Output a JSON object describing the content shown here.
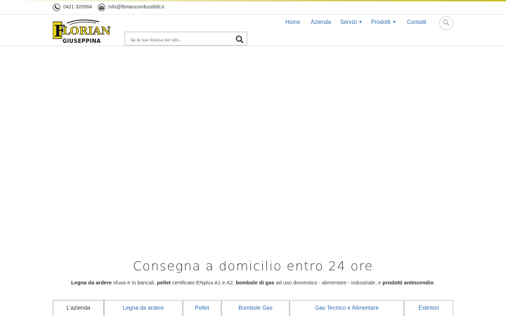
{
  "topbar": {
    "phone": "0421 320564",
    "email": "info@floriancombustibili.it"
  },
  "logo": {
    "line1": "FLORIAN",
    "line2": "GIUSEPPINA",
    "colors": {
      "yellow": "#e8d31a",
      "dark": "#111111"
    }
  },
  "search": {
    "placeholder": "fai la tua ricerca nel sito..."
  },
  "nav": {
    "items": [
      {
        "label": "Home",
        "dropdown": false
      },
      {
        "label": "Azienda",
        "dropdown": false
      },
      {
        "label": "Servizi",
        "dropdown": true
      },
      {
        "label": "Prodotti",
        "dropdown": true
      },
      {
        "label": "Contatti",
        "dropdown": false
      }
    ]
  },
  "hero": {
    "headline": "Consegna a domicilio entro 24 ore",
    "subline": [
      {
        "text": "Legna da ardere",
        "bold": true
      },
      {
        "text": " sfusa e in bancali, ",
        "bold": false
      },
      {
        "text": "pellet",
        "bold": true
      },
      {
        "text": " certificato ENplus A1 e A2, ",
        "bold": false
      },
      {
        "text": "bombole di gas",
        "bold": true
      },
      {
        "text": " ad uso domestico - alimentare - industriale, e ",
        "bold": false
      },
      {
        "text": "prodotti antincendio",
        "bold": true
      },
      {
        "text": ".",
        "bold": false
      }
    ]
  },
  "tabs": [
    {
      "label": "L'azienda",
      "active": true
    },
    {
      "label": "Legna da ardere",
      "active": false
    },
    {
      "label": "Pellet",
      "active": false
    },
    {
      "label": "Bombole Gas",
      "active": false
    },
    {
      "label": "Gas Tecnico e Alimentare",
      "active": false
    },
    {
      "label": "Estintori",
      "active": false
    }
  ],
  "colors": {
    "link": "#2f6fb0",
    "accent": "#c9bd1e"
  }
}
